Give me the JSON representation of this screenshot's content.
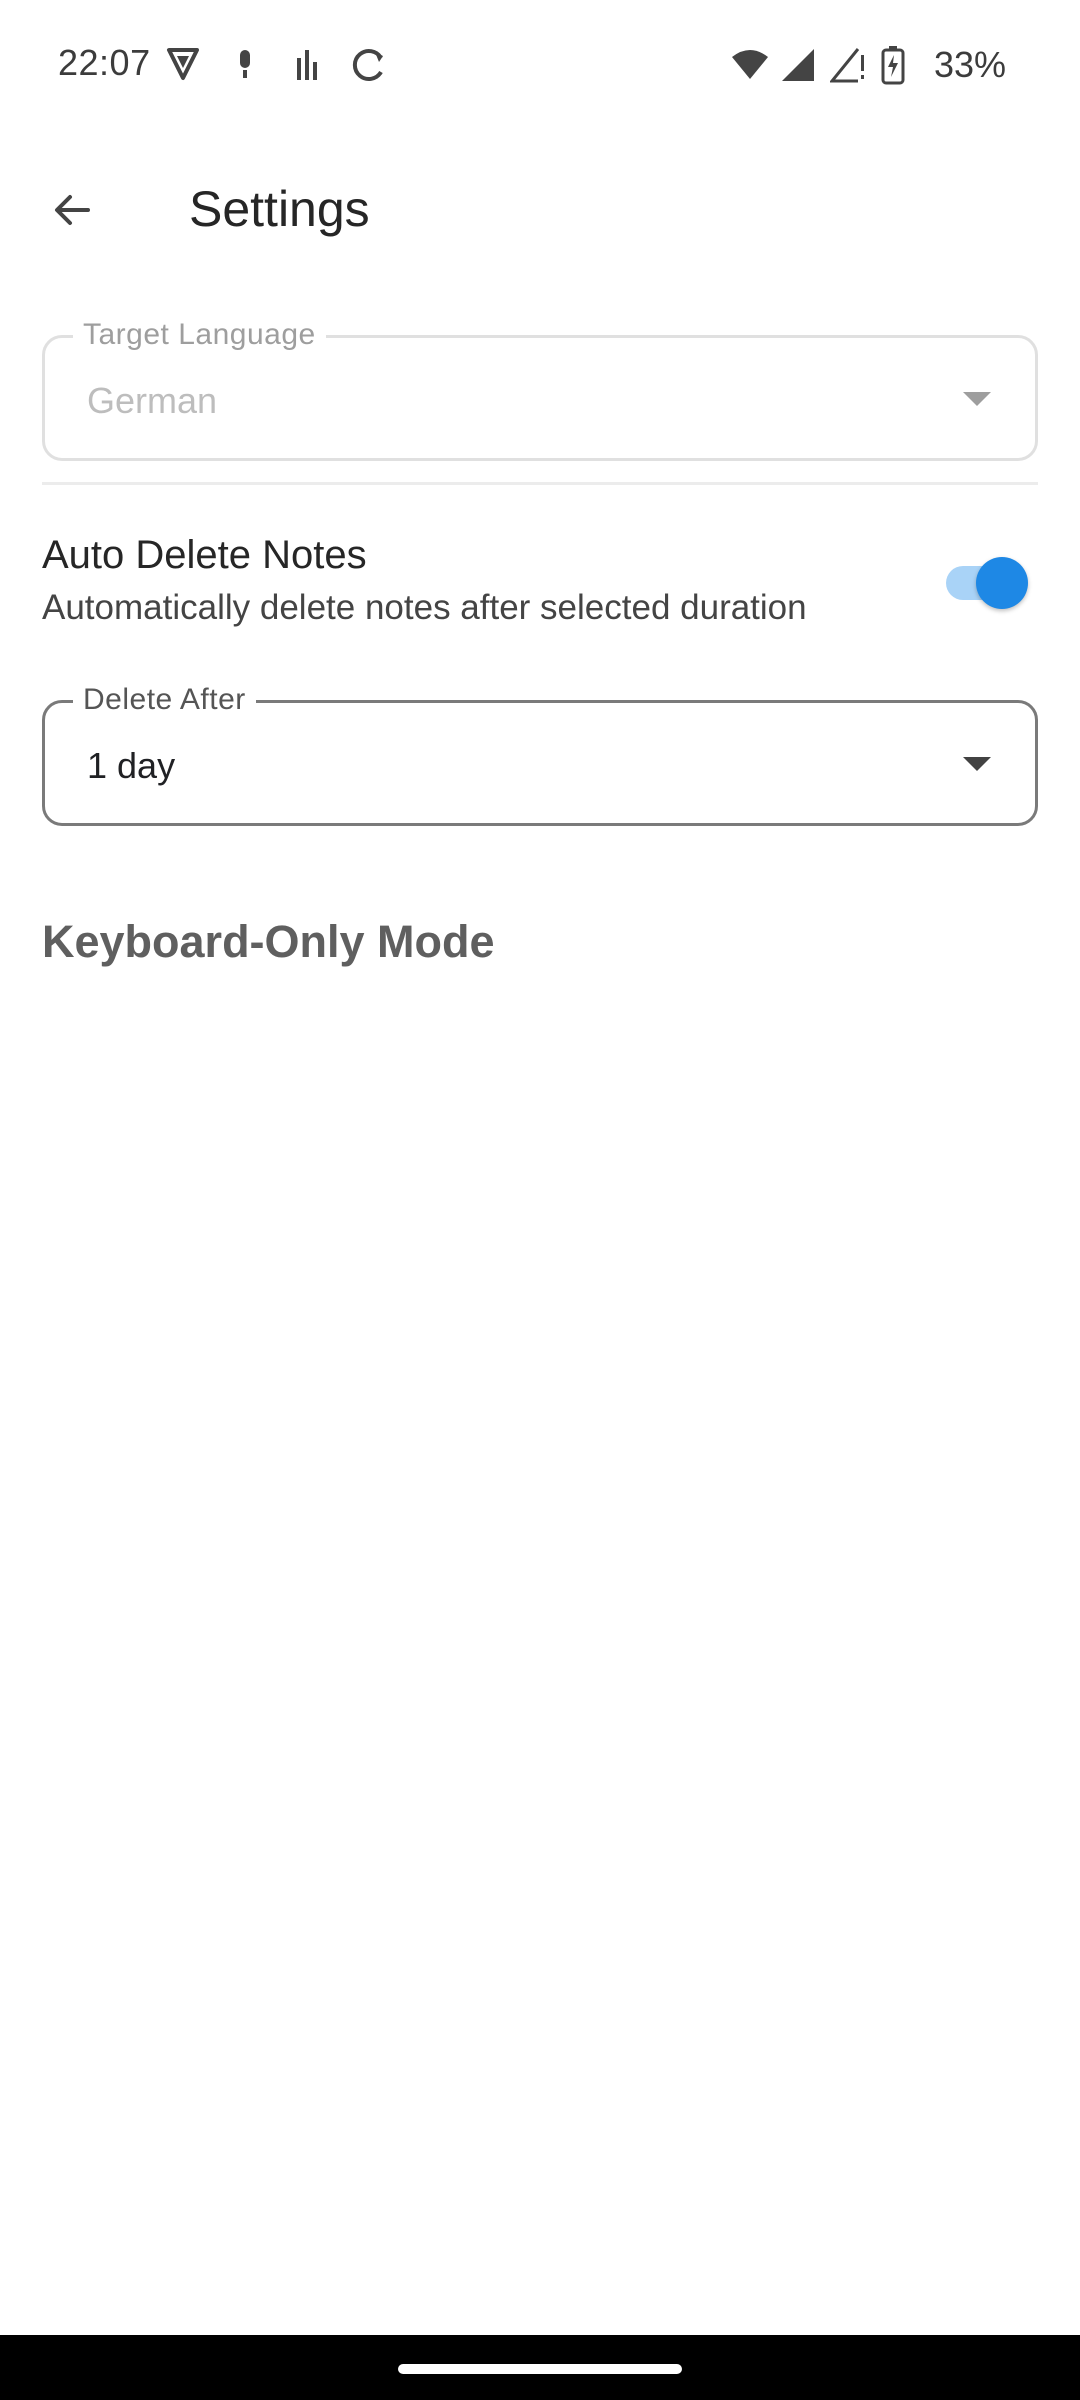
{
  "status_bar": {
    "time": "22:07",
    "battery_percent": "33%",
    "left_icons": [
      "vpn-shield-icon",
      "microphone-icon",
      "signal-bars-icon",
      "sync-icon"
    ],
    "right_icons": [
      "wifi-icon",
      "cell-signal-icon",
      "cell-signal-alert-icon",
      "battery-charging-icon"
    ]
  },
  "app_bar": {
    "back_icon": "arrow-left-icon",
    "title": "Settings"
  },
  "target_language": {
    "label": "Target Language",
    "value": "German",
    "enabled": false
  },
  "auto_delete": {
    "title": "Auto Delete Notes",
    "description": "Automatically delete notes after selected duration",
    "toggle_on": true,
    "accent_color": "#1e88e5"
  },
  "delete_after": {
    "label": "Delete After",
    "value": "1 day"
  },
  "keyboard_section": {
    "heading": "Keyboard-Only Mode"
  }
}
